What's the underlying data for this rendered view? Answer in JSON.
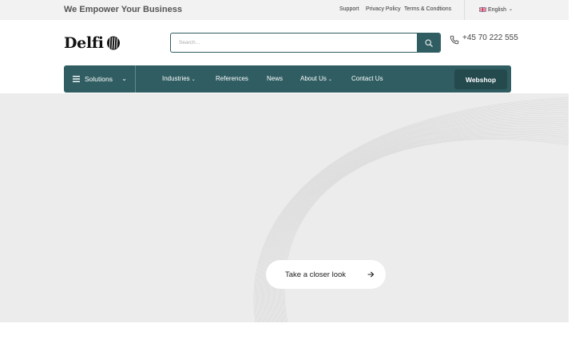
{
  "topbar": {
    "tagline": "We Empower Your Business",
    "links": [
      "Support",
      "Privacy Policy",
      "Terms & Condtions"
    ],
    "language": "English",
    "language_flag_icon": "uk-flag-icon"
  },
  "header": {
    "logo_text": "Delfi",
    "logo_icon": "delfi-logo-mark-icon",
    "search": {
      "placeholder": "Search...",
      "value": "",
      "button_icon": "search-icon"
    },
    "phone": {
      "icon": "phone-icon",
      "number": "+45 70 222 555"
    }
  },
  "nav": {
    "solutions_label": "Solutions",
    "solutions_icon": "hamburger-menu-icon",
    "items": [
      {
        "label": "Industries",
        "has_dropdown": true
      },
      {
        "label": "References",
        "has_dropdown": false
      },
      {
        "label": "News",
        "has_dropdown": false
      },
      {
        "label": "About Us",
        "has_dropdown": true
      },
      {
        "label": "Contact Us",
        "has_dropdown": false
      }
    ],
    "webshop_label": "Webshop"
  },
  "hero": {
    "cta_label": "Take a closer look",
    "cta_icon": "arrow-right-icon"
  },
  "colors": {
    "brand_teal": "#2f5d62",
    "webshop_dark": "#244a4e",
    "topbar_bg": "#f2f2f2",
    "hero_bg": "#ececec"
  }
}
